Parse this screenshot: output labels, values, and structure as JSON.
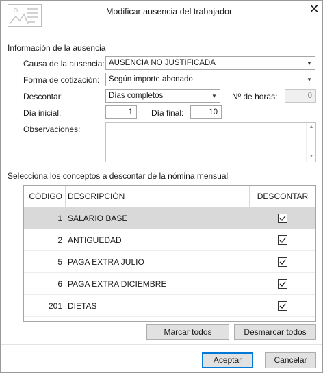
{
  "window": {
    "title": "Modificar ausencia del trabajador",
    "close_icon": "close-icon"
  },
  "info_section": {
    "title": "Información de la ausencia",
    "causa_label": "Causa de la ausencia:",
    "causa_value": "AUSENCIA NO JUSTIFICADA",
    "forma_label": "Forma de cotización:",
    "forma_value": "Según importe abonado",
    "descontar_label": "Descontar:",
    "descontar_value": "Días completos",
    "horas_label": "Nº de horas:",
    "horas_value": "0",
    "dia_inicial_label": "Día inicial:",
    "dia_inicial_value": "1",
    "dia_final_label": "Día final:",
    "dia_final_value": "10",
    "observaciones_label": "Observaciones:",
    "observaciones_value": ""
  },
  "conceptos_section": {
    "title": "Selecciona los conceptos a descontar de la nómina mensual",
    "headers": {
      "codigo": "CÓDIGO",
      "descripcion": "DESCRIPCIÓN",
      "descontar": "DESCONTAR"
    },
    "rows": [
      {
        "codigo": "1",
        "descripcion": "SALARIO BASE",
        "descontar": true,
        "selected": true
      },
      {
        "codigo": "2",
        "descripcion": "ANTIGUEDAD",
        "descontar": true,
        "selected": false
      },
      {
        "codigo": "5",
        "descripcion": "PAGA EXTRA JULIO",
        "descontar": true,
        "selected": false
      },
      {
        "codigo": "6",
        "descripcion": "PAGA EXTRA DICIEMBRE",
        "descontar": true,
        "selected": false
      },
      {
        "codigo": "201",
        "descripcion": "DIETAS",
        "descontar": true,
        "selected": false
      }
    ]
  },
  "buttons": {
    "marcar_todos": "Marcar todos",
    "desmarcar_todos": "Desmarcar todos",
    "aceptar": "Aceptar",
    "cancelar": "Cancelar"
  },
  "colors": {
    "selected_row": "#d9d9d9",
    "default_button_border": "#0078d7"
  }
}
